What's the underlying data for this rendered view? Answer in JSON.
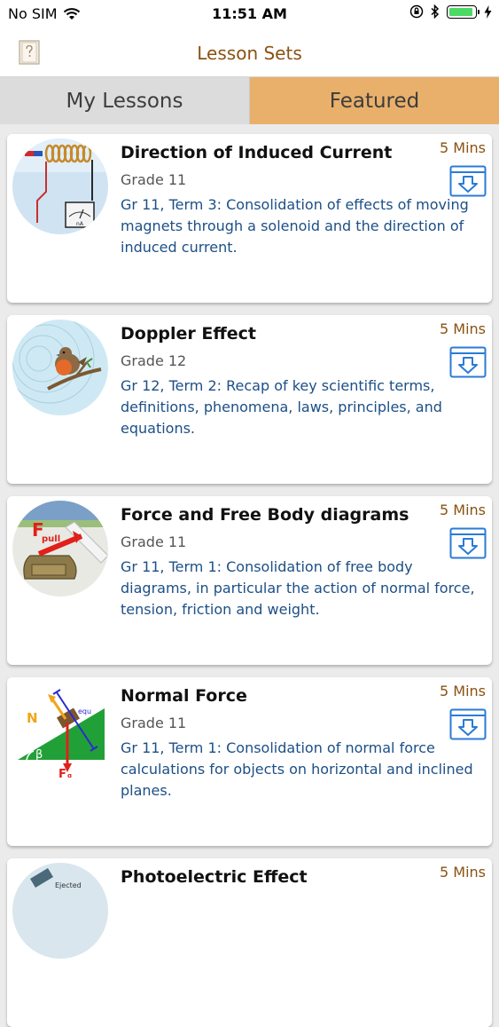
{
  "status": {
    "carrier": "No SIM",
    "time": "11:51 AM"
  },
  "nav": {
    "title": "Lesson Sets"
  },
  "segments": {
    "my_lessons": "My Lessons",
    "featured": "Featured",
    "selected": "Featured"
  },
  "lessons": [
    {
      "title": "Direction of Induced Current",
      "grade": "Grade 11",
      "description": "Gr 11, Term 3: Consolidation of effects of moving magnets through a solenoid and the direction of induced current.",
      "duration": "5 Mins",
      "thumb_label": "nA"
    },
    {
      "title": "Doppler Effect",
      "grade": "Grade 12",
      "description": "Gr 12, Term 2: Recap of key scientific terms, definitions, phenomena, laws, principles, and equations.",
      "duration": "5 Mins"
    },
    {
      "title": "Force and Free Body diagrams",
      "grade": "Grade 11",
      "description": "Gr 11, Term 1: Consolidation of free body diagrams, in particular the action of normal force, tension, friction and weight.",
      "duration": "5 Mins",
      "thumb_label": "F",
      "thumb_sub": "pull"
    },
    {
      "title": "Normal Force",
      "grade": "Grade 11",
      "description": "Gr 11, Term 1: Consolidation of normal force calculations for objects on horizontal and inclined planes.",
      "duration": "5 Mins",
      "thumb_labels": {
        "n": "N",
        "beta": "β",
        "f": "F",
        "g": "g",
        "equ": "equ"
      }
    },
    {
      "title": "Photoelectric Effect",
      "duration": "5 Mins",
      "thumb_label": "Ejected"
    }
  ],
  "colors": {
    "accent": "#8a5212",
    "featured_bg": "#e9b06b",
    "description": "#1c4f86",
    "download_icon": "#2a7bd6"
  }
}
